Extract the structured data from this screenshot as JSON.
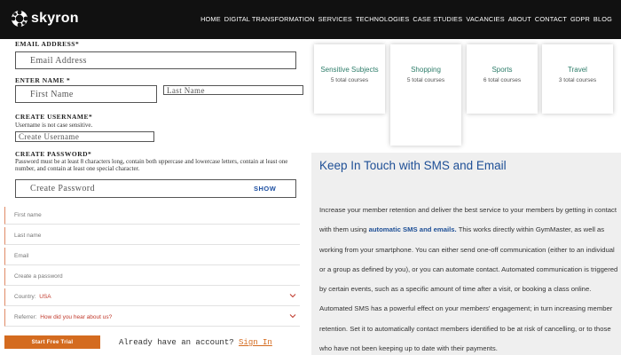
{
  "header": {
    "brand": "skyron",
    "nav": [
      "HOME",
      "DIGITAL TRANSFORMATION",
      "SERVICES",
      "TECHNOLOGIES",
      "CASE STUDIES",
      "VACANCIES",
      "ABOUT",
      "CONTACT",
      "GDPR",
      "BLOG"
    ]
  },
  "signup": {
    "email_label": "EMAIL ADDRESS*",
    "email_placeholder": "Email Address",
    "name_label": "ENTER NAME *",
    "first_placeholder": "First Name",
    "last_placeholder": "Last Name",
    "username_label": "CREATE USERNAME*",
    "username_help": "Username is not case sensitive.",
    "username_placeholder": "Create Username",
    "password_label": "CREATE PASSWORD*",
    "password_help": "Password must be at least 8 characters long, contain both uppercase and lowercase letters, contain at least one number, and contain at least one special character.",
    "password_placeholder": "Create Password",
    "show_label": "SHOW"
  },
  "trial_form": {
    "first_name": "First name",
    "last_name": "Last name",
    "email": "Email",
    "password": "Create a password",
    "country_label": "Country:",
    "country_value": "USA",
    "referrer_label": "Referrer:",
    "referrer_value": "How did you hear about us?",
    "submit": "Start Free Trial",
    "already_text": "Already have an account?",
    "signin_link": "Sign In"
  },
  "courses": [
    {
      "title": "Sensitive Subjects",
      "count": "5 total courses"
    },
    {
      "title": "Shopping",
      "count": "5 total courses"
    },
    {
      "title": "Sports",
      "count": "6 total courses"
    },
    {
      "title": "Travel",
      "count": "3 total courses"
    }
  ],
  "sms": {
    "title": "Keep In Touch with SMS and Email",
    "body_1": "Increase your member retention and deliver the best service to your members by getting in contact with them using",
    "body_link": "automatic SMS and emails.",
    "body_2": "This works directly within GymMaster, as well as working from your smartphone. You can either send one-off communication (either to an individual or a group as defined by you), or you can automate contact. Automated communication is triggered by certain events, such as a specific amount of time after a visit, or booking a class online. Automated SMS has a powerful effect on your members' engagement; in turn increasing member retention. Set it to automatically contact members identified to be at risk of cancelling, or to those who have not been keeping up to date with their payments."
  },
  "colors": {
    "header_bg": "#111111",
    "accent_orange": "#d46b1f",
    "title_blue": "#1e4f96",
    "course_green": "#2e7d6a",
    "panel_bg": "#efefef"
  }
}
